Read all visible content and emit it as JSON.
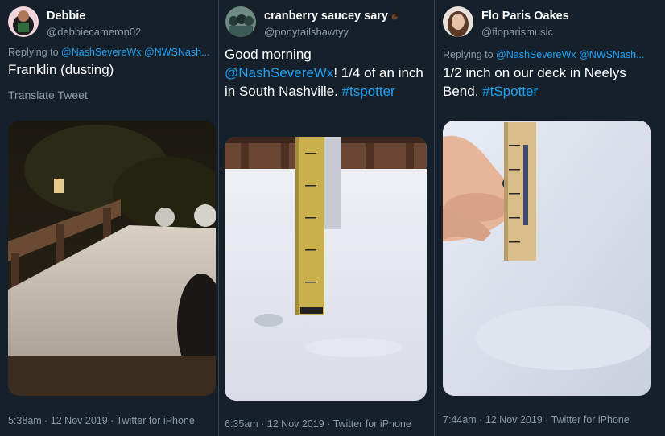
{
  "tweets": [
    {
      "name": "Debbie",
      "handle": "@debbiecameron02",
      "replying_prefix": "Replying to",
      "replying_mentions": [
        "@NashSevereWx",
        "@NWSNash..."
      ],
      "text_parts": [
        {
          "text": "Franklin (dusting)",
          "type": "plain"
        }
      ],
      "translate": "Translate Tweet",
      "meta": "5:38am · 12 Nov 2019 · Twitter for iPhone"
    },
    {
      "name": "cranberry saucey sary",
      "handle": "@ponytailshawtyy",
      "text_parts": [
        {
          "text": "Good morning ",
          "type": "plain"
        },
        {
          "text": "@NashSevereWx",
          "type": "link"
        },
        {
          "text": "! 1/4 of an inch in South Nashville. ",
          "type": "plain"
        },
        {
          "text": "#tspotter",
          "type": "link"
        }
      ],
      "meta": "6:35am · 12 Nov 2019 · Twitter for iPhone"
    },
    {
      "name": "Flo Paris Oakes",
      "handle": "@floparismusic",
      "replying_prefix": "Replying to",
      "replying_mentions": [
        "@NashSevereWx",
        "@NWSNash..."
      ],
      "text_parts": [
        {
          "text": "1/2 inch on our deck in Neelys Bend. ",
          "type": "plain"
        },
        {
          "text": "#tSpotter",
          "type": "link"
        }
      ],
      "meta": "7:44am · 12 Nov 2019 · Twitter for iPhone"
    }
  ],
  "icons": {
    "emoji": "guitar-emoji-icon"
  },
  "colors": {
    "background": "#15202b",
    "accent": "#1da1f2",
    "secondary_text": "#8899a6"
  }
}
